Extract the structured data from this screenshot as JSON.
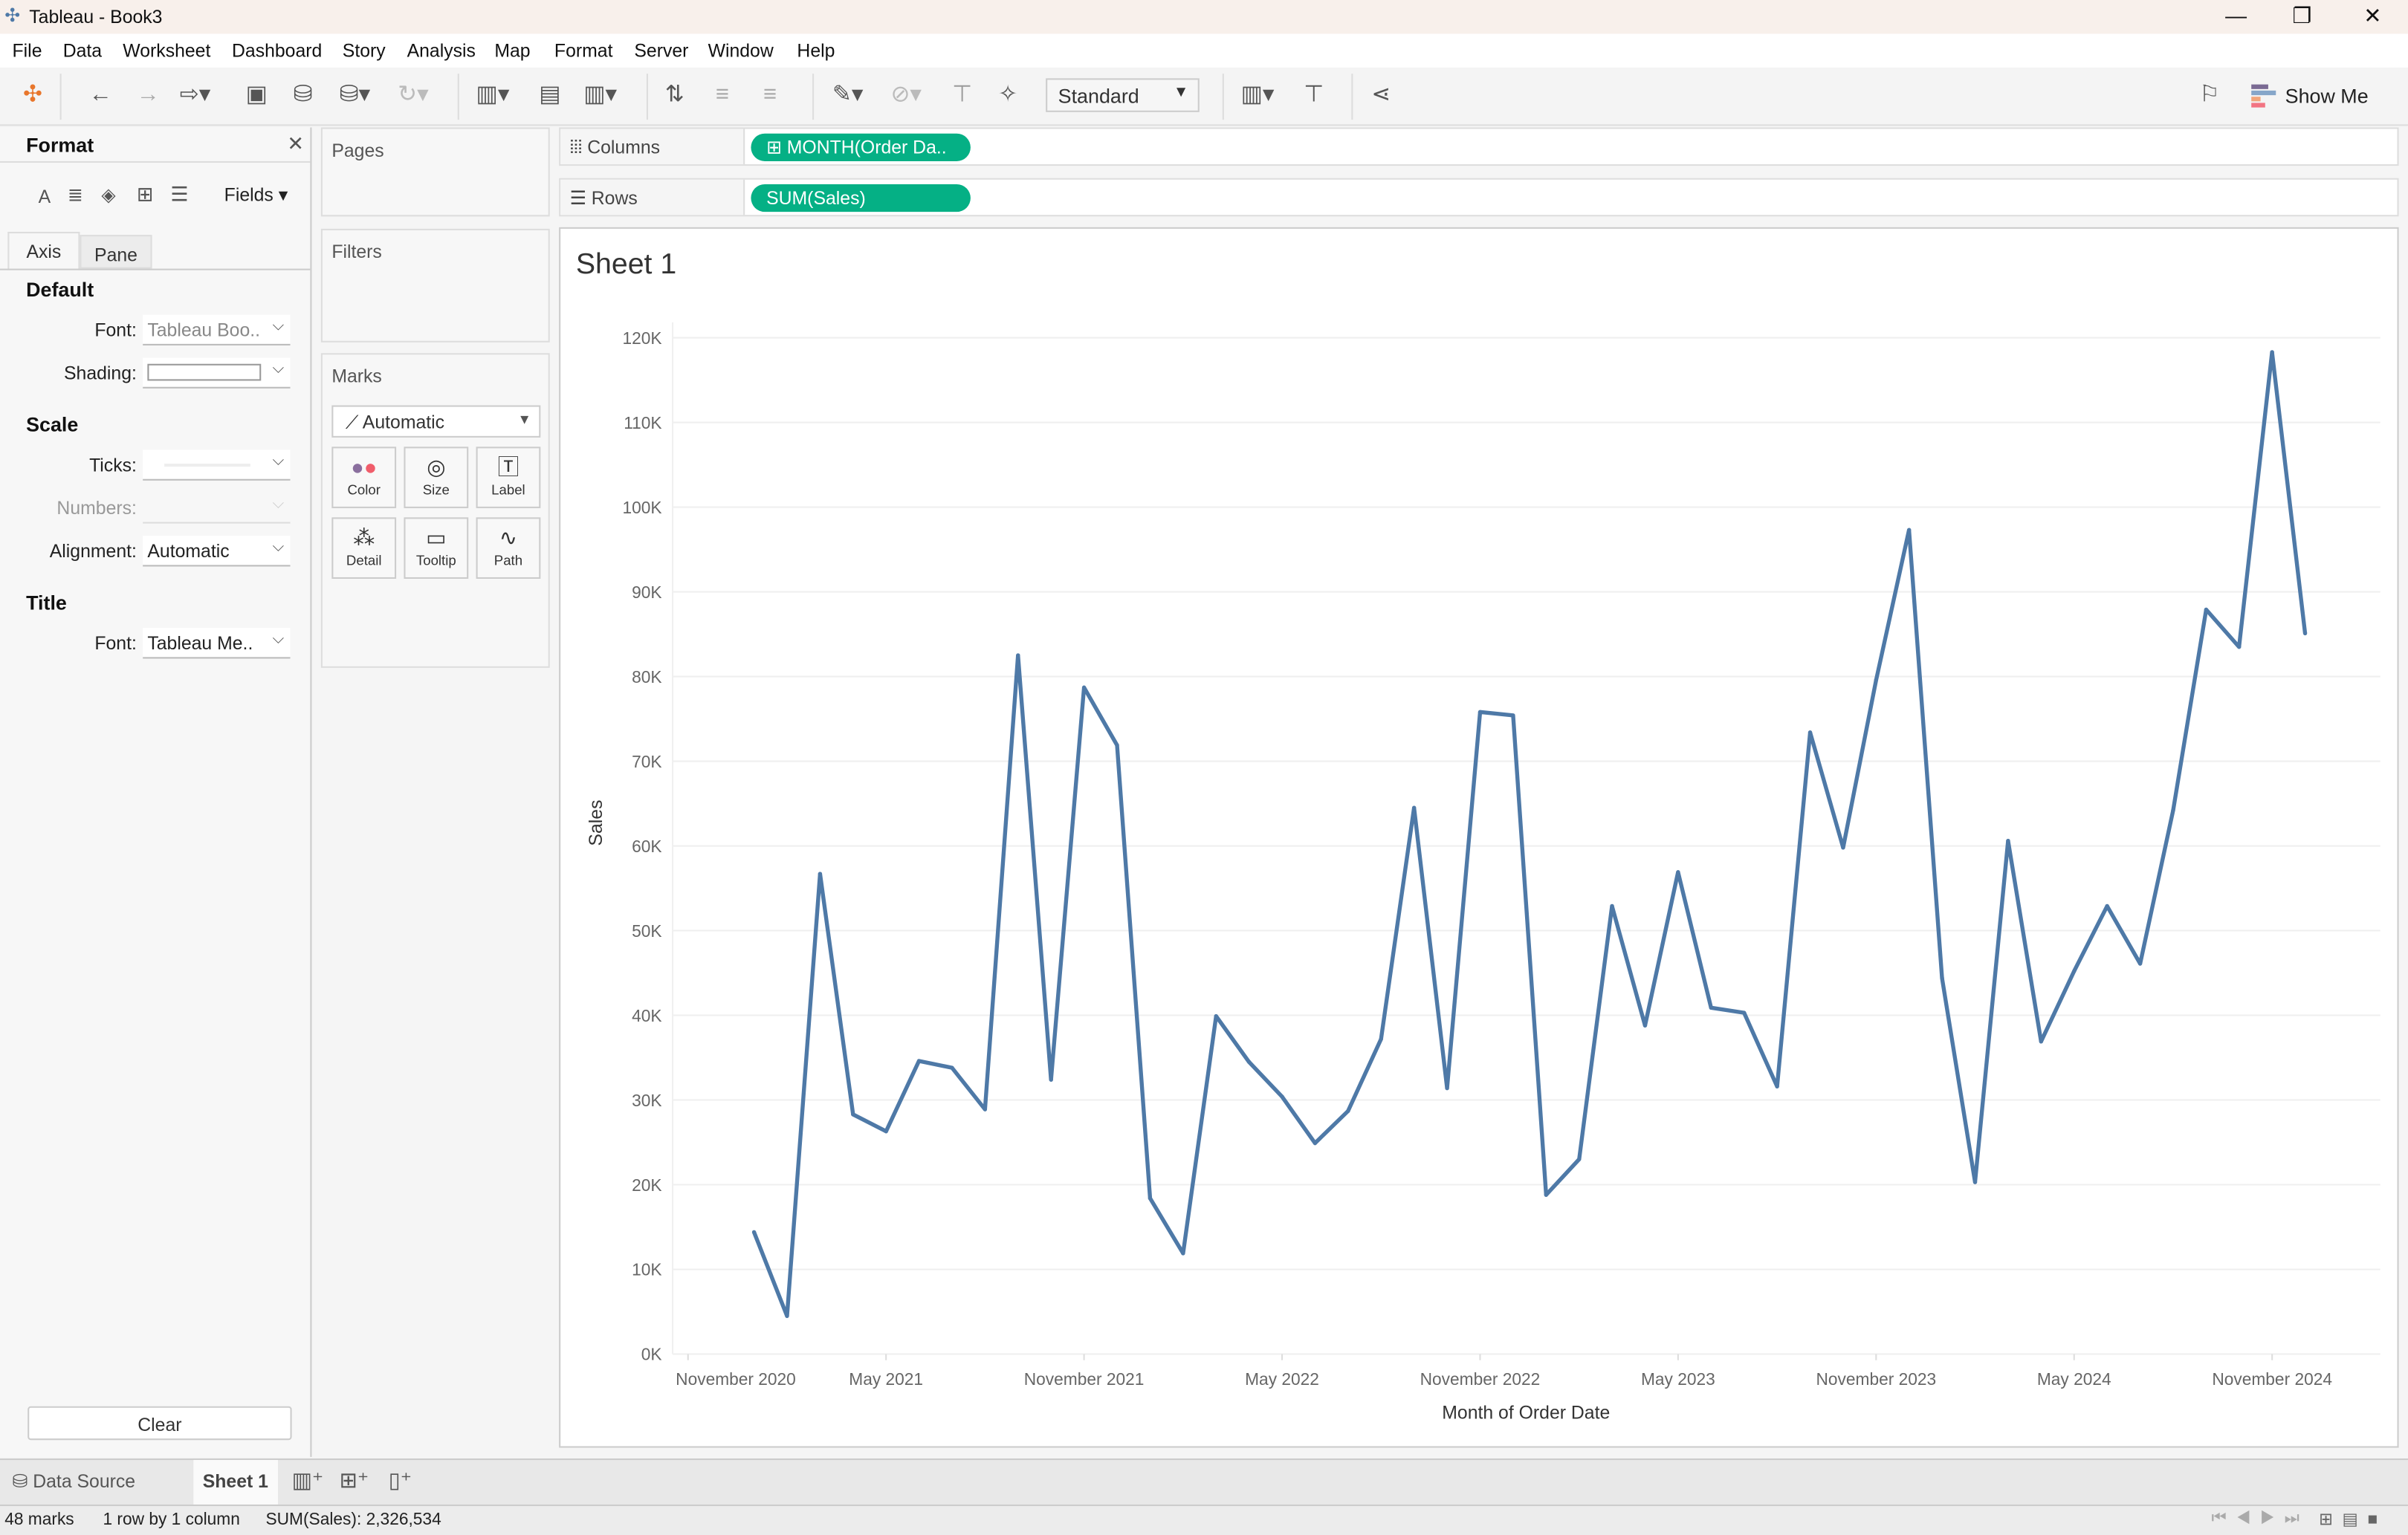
{
  "window": {
    "title": "Tableau - Book3",
    "controls": [
      "minimize",
      "restore",
      "close"
    ]
  },
  "menu": [
    "File",
    "Data",
    "Worksheet",
    "Dashboard",
    "Story",
    "Analysis",
    "Map",
    "Format",
    "Server",
    "Window",
    "Help"
  ],
  "toolbar": {
    "fit_select": "Standard",
    "show_me": "Show Me"
  },
  "format_pane": {
    "title": "Format",
    "fields_label": "Fields",
    "tabs": [
      "Axis",
      "Pane"
    ],
    "active_tab": "Axis",
    "sections": {
      "default": "Default",
      "scale": "Scale",
      "title": "Title"
    },
    "rows": {
      "font_label": "Font:",
      "font_value": "Tableau Boo..",
      "shading_label": "Shading:",
      "ticks_label": "Ticks:",
      "numbers_label": "Numbers:",
      "alignment_label": "Alignment:",
      "alignment_value": "Automatic",
      "title_font_label": "Font:",
      "title_font_value": "Tableau Me.."
    },
    "clear_label": "Clear"
  },
  "cards": {
    "pages": "Pages",
    "filters": "Filters",
    "marks": "Marks",
    "mark_type": "Automatic",
    "mark_buttons": [
      "Color",
      "Size",
      "Label",
      "Detail",
      "Tooltip",
      "Path"
    ]
  },
  "shelves": {
    "columns_label": "Columns",
    "columns_pill": "MONTH(Order Da..",
    "rows_label": "Rows",
    "rows_pill": "SUM(Sales)"
  },
  "colors": {
    "line": "#4e79a7",
    "pill": "#05b085"
  },
  "chart_data": {
    "type": "line",
    "title": "Sheet 1",
    "xlabel": "Month of Order Date",
    "ylabel": "Sales",
    "ylim": [
      0,
      120000
    ],
    "yticks": [
      "0K",
      "10K",
      "20K",
      "30K",
      "40K",
      "50K",
      "60K",
      "70K",
      "80K",
      "90K",
      "100K",
      "110K",
      "120K"
    ],
    "xrange": [
      "2021-01",
      "2024-12"
    ],
    "xticks": [
      {
        "date": "2020-11",
        "label": "November 2020"
      },
      {
        "date": "2021-05",
        "label": "May 2021"
      },
      {
        "date": "2021-11",
        "label": "November 2021"
      },
      {
        "date": "2022-05",
        "label": "May 2022"
      },
      {
        "date": "2022-11",
        "label": "November 2022"
      },
      {
        "date": "2023-05",
        "label": "May 2023"
      },
      {
        "date": "2023-11",
        "label": "November 2023"
      },
      {
        "date": "2024-05",
        "label": "May 2024"
      },
      {
        "date": "2024-11",
        "label": "November 2024"
      }
    ],
    "grid": true,
    "x": [
      "2021-01",
      "2021-02",
      "2021-03",
      "2021-04",
      "2021-05",
      "2021-06",
      "2021-07",
      "2021-08",
      "2021-09",
      "2021-10",
      "2021-11",
      "2021-12",
      "2022-01",
      "2022-02",
      "2022-03",
      "2022-04",
      "2022-05",
      "2022-06",
      "2022-07",
      "2022-08",
      "2022-09",
      "2022-10",
      "2022-11",
      "2022-12",
      "2023-01",
      "2023-02",
      "2023-03",
      "2023-04",
      "2023-05",
      "2023-06",
      "2023-07",
      "2023-08",
      "2023-09",
      "2023-10",
      "2023-11",
      "2023-12",
      "2024-01",
      "2024-02",
      "2024-03",
      "2024-04",
      "2024-05",
      "2024-06",
      "2024-07",
      "2024-08",
      "2024-09",
      "2024-10",
      "2024-11",
      "2024-12"
    ],
    "values": [
      14400,
      4500,
      56700,
      28300,
      26300,
      34600,
      33800,
      28900,
      82500,
      32400,
      78700,
      71900,
      18400,
      11900,
      39900,
      34500,
      30400,
      24900,
      28700,
      37200,
      64500,
      31400,
      75800,
      75400,
      18800,
      23000,
      52900,
      38800,
      56900,
      40900,
      40300,
      31600,
      73400,
      59800,
      79600,
      97300,
      44400,
      20300,
      60600,
      36900,
      45200,
      52900,
      46100,
      64200,
      87900,
      83500,
      118300,
      85100
    ]
  },
  "sheet_tabs": {
    "data_source": "Data Source",
    "active": "Sheet 1"
  },
  "status": {
    "marks": "48 marks",
    "dims": "1 row by 1 column",
    "sum": "SUM(Sales): 2,326,534"
  }
}
